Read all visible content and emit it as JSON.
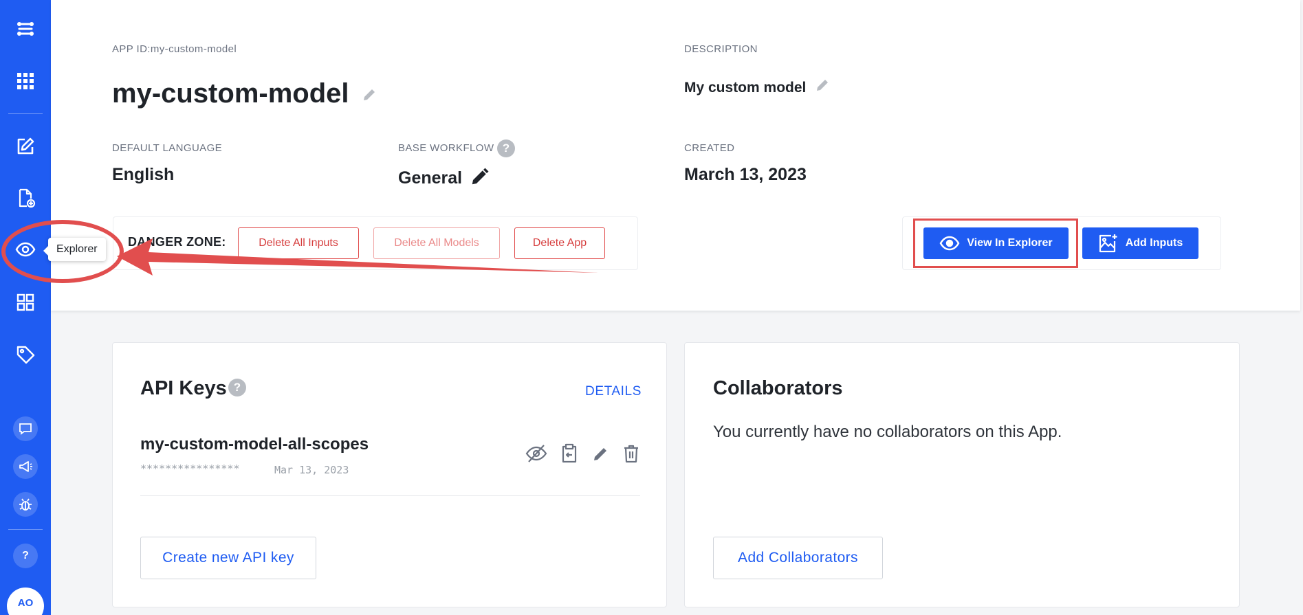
{
  "sidebar": {
    "items": [
      {
        "icon": "logo-icon"
      },
      {
        "icon": "apps-grid-icon"
      },
      {
        "icon": "edit-icon"
      },
      {
        "icon": "new-file-icon"
      },
      {
        "icon": "eye-icon",
        "tooltip": "Explorer"
      },
      {
        "icon": "models-grid-icon"
      },
      {
        "icon": "tag-icon"
      },
      {
        "icon": "chat-icon"
      },
      {
        "icon": "megaphone-icon"
      },
      {
        "icon": "bug-icon"
      }
    ],
    "help_label": "?",
    "avatar_initials": "AO"
  },
  "app": {
    "app_id_label": "APP ID:my-custom-model",
    "name": "my-custom-model",
    "description_label": "DESCRIPTION",
    "description": "My custom model",
    "default_language_label": "DEFAULT LANGUAGE",
    "default_language": "English",
    "base_workflow_label": "BASE WORKFLOW",
    "base_workflow": "General",
    "created_label": "CREATED",
    "created": "March 13, 2023"
  },
  "danger_zone": {
    "label": "DANGER ZONE:",
    "delete_inputs": "Delete All Inputs",
    "delete_models": "Delete All Models",
    "delete_app": "Delete App"
  },
  "actions": {
    "view_explorer": "View In Explorer",
    "add_inputs": "Add Inputs"
  },
  "api_keys": {
    "title": "API Keys",
    "details_link": "DETAILS",
    "key_name": "my-custom-model-all-scopes",
    "key_masked": "****************",
    "key_date": "Mar 13, 2023",
    "create_button": "Create new API key"
  },
  "collaborators": {
    "title": "Collaborators",
    "empty_text": "You currently have no collaborators on this App.",
    "add_button": "Add Collaborators"
  },
  "colors": {
    "primary": "#1f5cf2",
    "danger": "#e04848",
    "annotation": "#e14e4e"
  }
}
